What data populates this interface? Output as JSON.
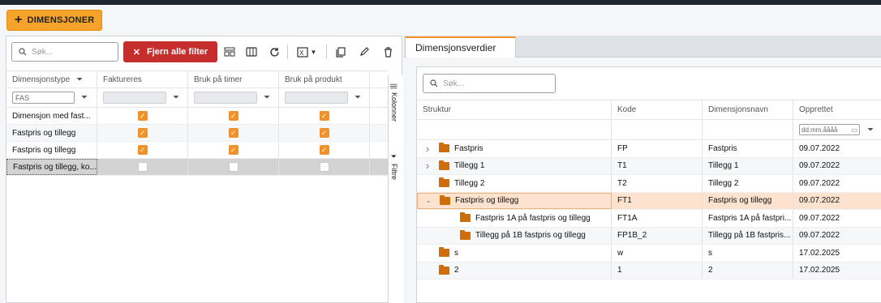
{
  "toolbar": {
    "add_label": "DIMENSJONER"
  },
  "left": {
    "search_placeholder": "Søk...",
    "clear_filters_label": "Fjern alle filter",
    "columns": [
      "Dimensjonstype",
      "Faktureres",
      "Bruk på timer",
      "Bruk på produkt"
    ],
    "filter_value": "FAS",
    "rows": [
      {
        "name": "Dimensjon med fast...",
        "faktureres": true,
        "timer": true,
        "produkt": true
      },
      {
        "name": "Fastpris og tillegg",
        "faktureres": true,
        "timer": true,
        "produkt": true
      },
      {
        "name": "Fastpris og tillegg",
        "faktureres": true,
        "timer": true,
        "produkt": true
      },
      {
        "name": "Fastpris og tillegg, ko...",
        "faktureres": false,
        "timer": false,
        "produkt": false
      }
    ],
    "side_tabs": {
      "columns": "Kolonner",
      "filter": "Filtre"
    }
  },
  "right": {
    "tab_label": "Dimensjonsverdier",
    "search_placeholder": "Søk...",
    "columns": [
      "Struktur",
      "Kode",
      "Dimensjonsnavn",
      "Opprettet"
    ],
    "date_placeholder": "dd.mm.åååå",
    "rows": [
      {
        "struktur": "Fastpris",
        "kode": "FP",
        "navn": "Fastpris",
        "opprettet": "09.07.2022",
        "level": 0,
        "expander": "right"
      },
      {
        "struktur": "Tillegg 1",
        "kode": "T1",
        "navn": "Tillegg 1",
        "opprettet": "09.07.2022",
        "level": 0,
        "expander": "right"
      },
      {
        "struktur": "Tillegg 2",
        "kode": "T2",
        "navn": "Tillegg 2",
        "opprettet": "09.07.2022",
        "level": 0,
        "expander": ""
      },
      {
        "struktur": "Fastpris og tillegg",
        "kode": "FT1",
        "navn": "Fastpris og tillegg",
        "opprettet": "09.07.2022",
        "level": 0,
        "expander": "down"
      },
      {
        "struktur": "Fastpris 1A på fastpris og tillegg",
        "kode": "FT1A",
        "navn": "Fastpris 1A på fastpri...",
        "opprettet": "09.07.2022",
        "level": 1,
        "expander": ""
      },
      {
        "struktur": "Tillegg på 1B fastpris og tillegg",
        "kode": "FP1B_2",
        "navn": "Tillegg på 1B fastpris...",
        "opprettet": "09.07.2022",
        "level": 1,
        "expander": ""
      },
      {
        "struktur": "s",
        "kode": "w",
        "navn": "s",
        "opprettet": "17.02.2025",
        "level": 0,
        "expander": ""
      },
      {
        "struktur": "2",
        "kode": "1",
        "navn": "2",
        "opprettet": "17.02.2025",
        "level": 0,
        "expander": ""
      }
    ]
  },
  "colors": {
    "accent": "#f0912a",
    "danger": "#c62e2e",
    "folder": "#cf6d0d",
    "selected_row": "#fde3cf"
  }
}
